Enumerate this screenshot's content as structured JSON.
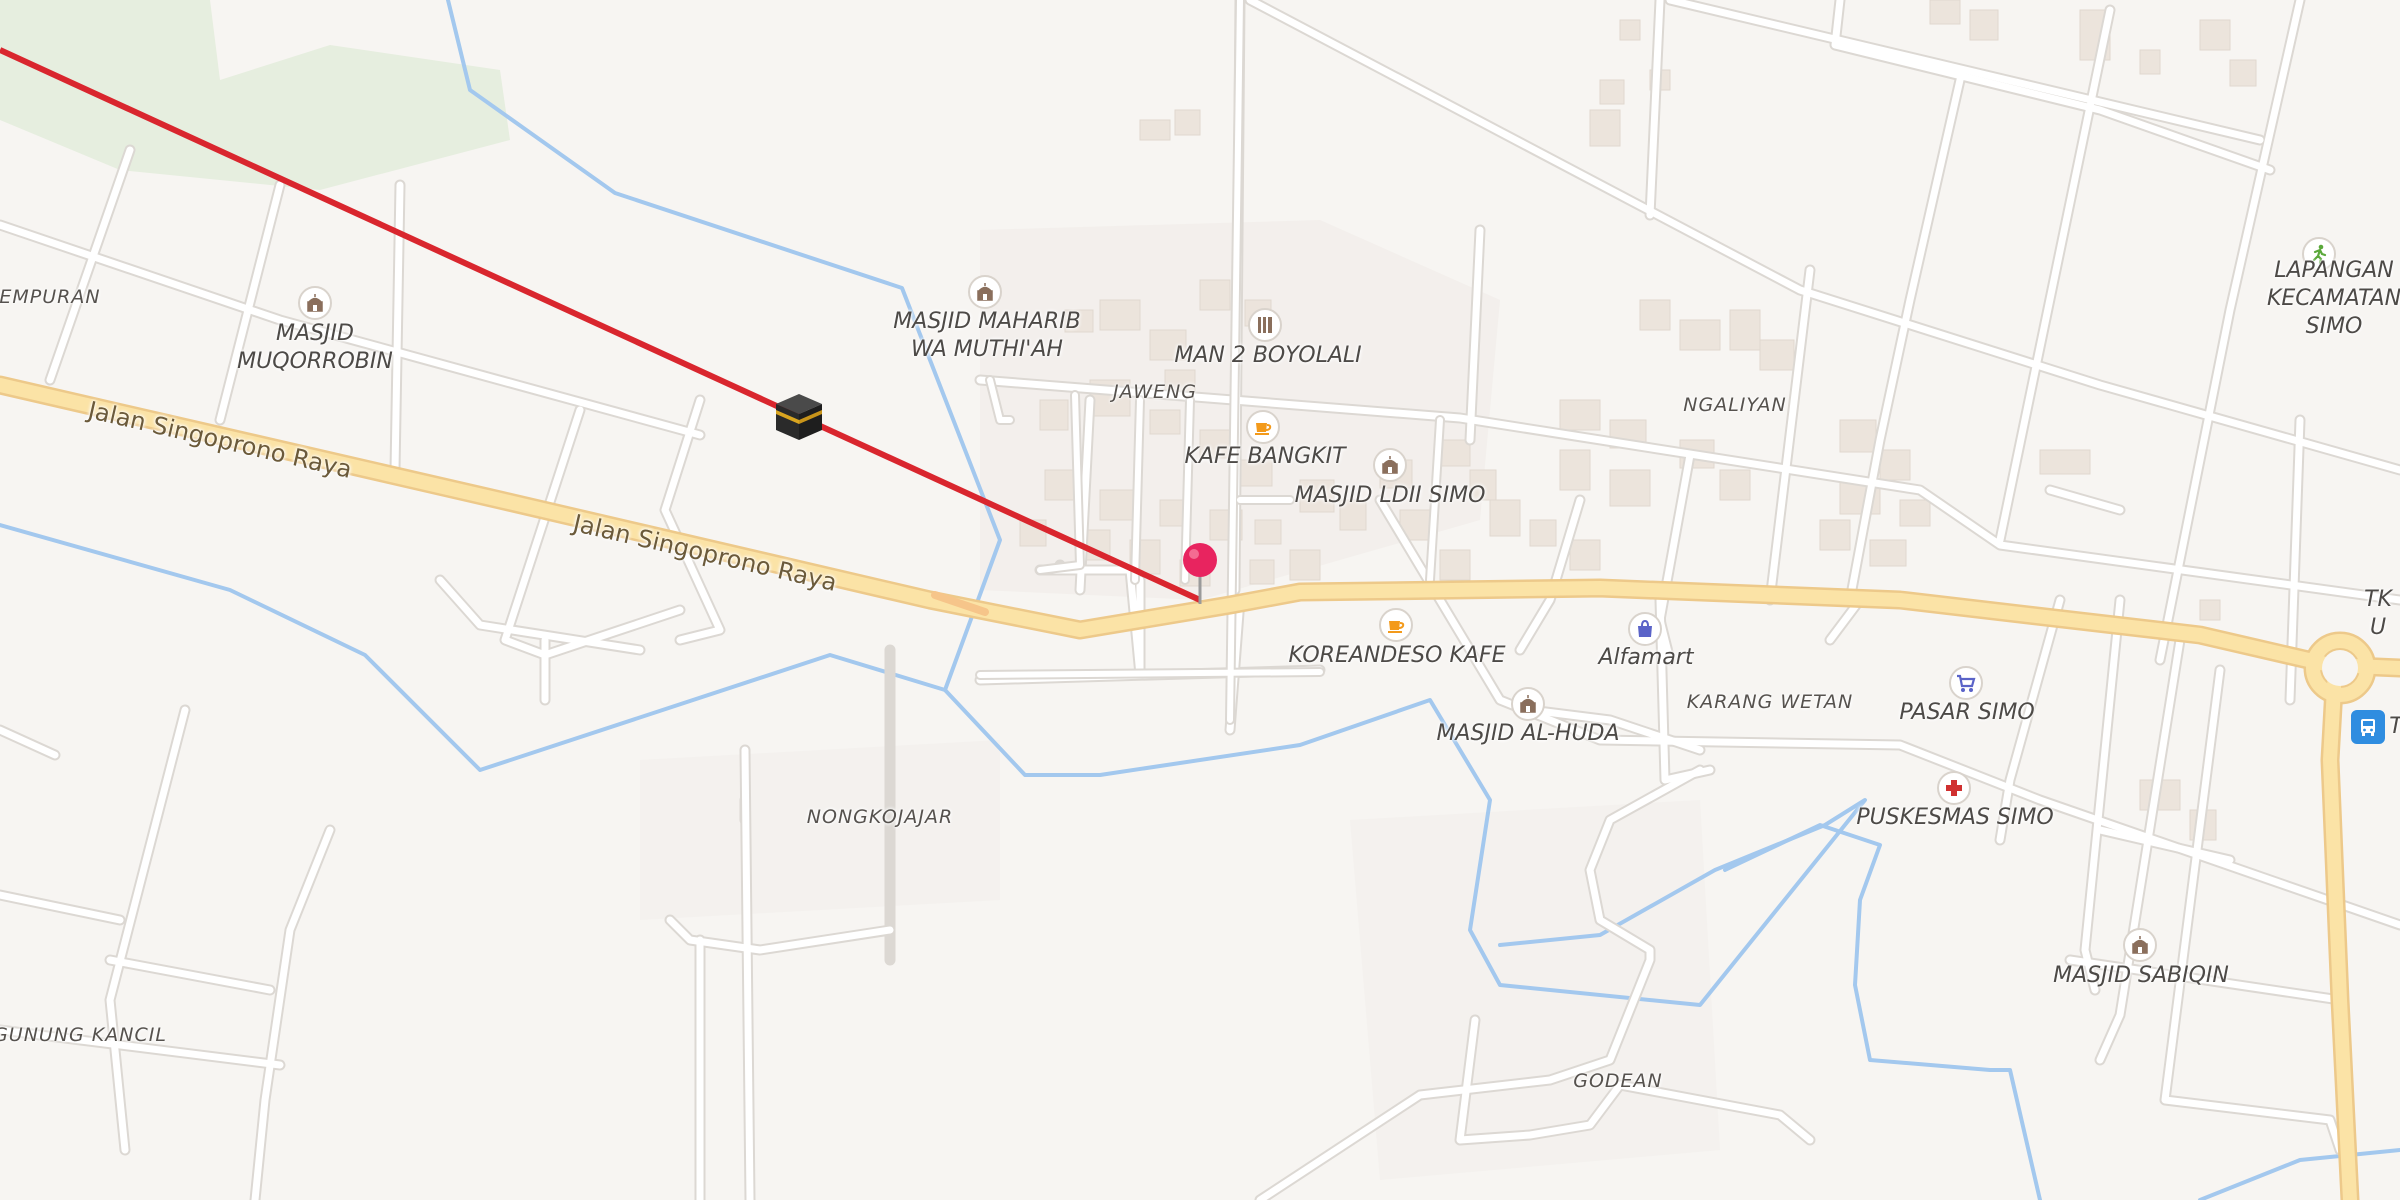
{
  "colors": {
    "background": "#f7f5f2",
    "main_road": "#fbe3a6",
    "main_road_casing": "#edc98a",
    "minor_road": "#ffffff",
    "minor_road_casing": "#dedad5",
    "water": "#a3c8ee",
    "park": "#e6eedf",
    "building": "#ece6df",
    "qibla_line": "#d9262e",
    "pin": "#e8245f"
  },
  "roads": {
    "main": [
      "Jalan Singoprono Raya",
      "Jalan Singoprono Raya"
    ]
  },
  "areas": {
    "kempuran": "EMPURAN",
    "jaweng": "JAWENG",
    "ngaliyan": "NGALIYAN",
    "nongkojajar": "NONGKOJAJAR",
    "karang_wetan": "KARANG WETAN",
    "gunung_kancil": "GUNUNG KANCIL",
    "godean": "GODEAN"
  },
  "pois": [
    {
      "id": "masjid-muqorrobin",
      "label": "MASJID\nMUQORROBIN",
      "icon": "mosque-icon",
      "color": "#8a6f5c"
    },
    {
      "id": "masjid-maharib",
      "label": "MASJID MAHARIB\nWA MUTHI'AH",
      "icon": "mosque-icon",
      "color": "#8a6f5c"
    },
    {
      "id": "man2",
      "label": "MAN 2 BOYOLALI",
      "icon": "school-icon",
      "color": "#8a6f5c"
    },
    {
      "id": "kafe-bangkit",
      "label": "KAFE BANGKIT",
      "icon": "cafe-icon",
      "color": "#f39a1b"
    },
    {
      "id": "masjid-ldii",
      "label": "MASJID LDII SIMO",
      "icon": "mosque-icon",
      "color": "#8a6f5c"
    },
    {
      "id": "koreandeso",
      "label": "KOREANDESO KAFE",
      "icon": "cafe-icon",
      "color": "#f39a1b"
    },
    {
      "id": "alfamart",
      "label": "Alfamart",
      "icon": "shopping-bag-icon",
      "color": "#5a63c8"
    },
    {
      "id": "masjid-alhuda",
      "label": "MASJID AL-HUDA",
      "icon": "mosque-icon",
      "color": "#8a6f5c"
    },
    {
      "id": "pasar-simo",
      "label": "PASAR SIMO",
      "icon": "shopping-cart-icon",
      "color": "#5a63c8"
    },
    {
      "id": "puskesmas",
      "label": "PUSKESMAS SIMO",
      "icon": "hospital-cross-icon",
      "color": "#d03030"
    },
    {
      "id": "masjid-sabiqin",
      "label": "MASJID SABIQIN",
      "icon": "mosque-icon",
      "color": "#8a6f5c"
    },
    {
      "id": "lapangan",
      "label": "LAPANGAN\nKECAMATAN SIMO",
      "icon": "running-person-icon",
      "color": "#5aa83a"
    },
    {
      "id": "tk",
      "label": "TK U",
      "icon": "",
      "color": ""
    },
    {
      "id": "bus",
      "label": "T",
      "icon": "bus-icon",
      "color": "#2f8de0"
    }
  ],
  "markers": {
    "location_pin": {
      "icon": "location-pin-icon"
    },
    "kaaba": {
      "icon": "kaaba-icon"
    }
  }
}
